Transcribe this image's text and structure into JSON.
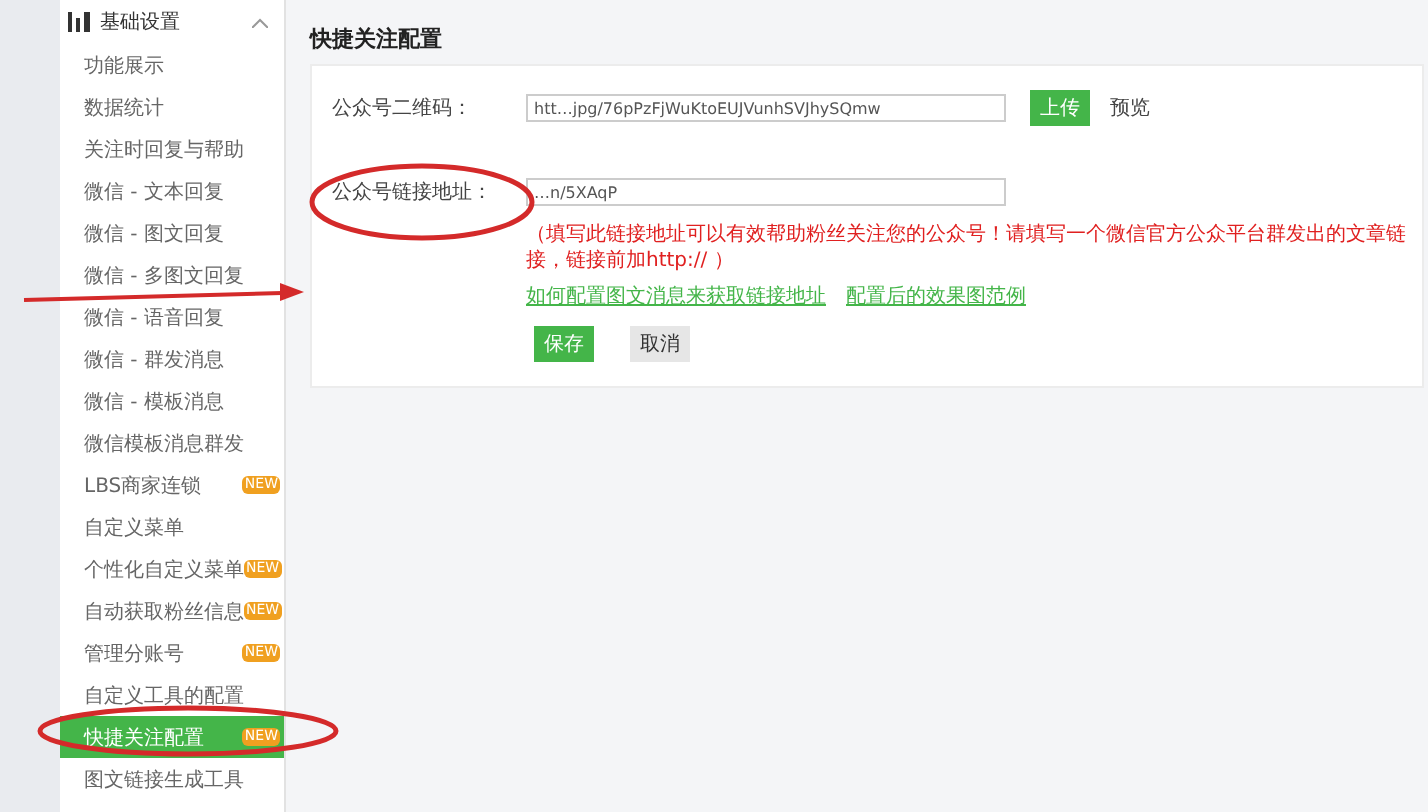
{
  "sidebar": {
    "header": {
      "title": "基础设置",
      "expanded": true
    },
    "items": [
      {
        "label": "功能展示",
        "selected": false
      },
      {
        "label": "数据统计",
        "selected": false
      },
      {
        "label": "关注时回复与帮助",
        "selected": false
      },
      {
        "label": "微信 - 文本回复",
        "selected": false
      },
      {
        "label": "微信 - 图文回复",
        "selected": false
      },
      {
        "label": "微信 - 多图文回复",
        "selected": false
      },
      {
        "label": "微信 - 语音回复",
        "selected": false
      },
      {
        "label": "微信 - 群发消息",
        "selected": false
      },
      {
        "label": "微信 - 模板消息",
        "selected": false
      },
      {
        "label": "微信模板消息群发",
        "selected": false
      },
      {
        "label": "LBS商家连锁",
        "selected": false,
        "badge": "NEW"
      },
      {
        "label": "自定义菜单",
        "selected": false
      },
      {
        "label": "个性化自定义菜单",
        "selected": false,
        "badge": "NEW"
      },
      {
        "label": "自动获取粉丝信息",
        "selected": false,
        "badge": "NEW"
      },
      {
        "label": "管理分账号",
        "selected": false,
        "badge": "NEW"
      },
      {
        "label": "自定义工具的配置",
        "selected": false
      },
      {
        "label": "快捷关注配置",
        "selected": true,
        "badge": "NEW"
      },
      {
        "label": "图文链接生成工具",
        "selected": false
      }
    ]
  },
  "main": {
    "title": "快捷关注配置",
    "fields": [
      {
        "kind": "qr",
        "label": "公众号二维码：",
        "value": "htt…jpg/76pPzFjWuKtoEUJVunhSVJhySQmw",
        "upload": "上传",
        "preview": "预览"
      },
      {
        "kind": "link",
        "label": "公众号链接地址：",
        "value": "…n/5XAqP"
      }
    ],
    "hint": "（填写此链接地址可以有效帮助粉丝关注您的公众号！请填写一个微信官方公众平台群发出的文章链接，链接前加http:// ）",
    "links": [
      "如何配置图文消息来获取链接地址",
      "配置后的效果图范例"
    ],
    "buttons": [
      {
        "label": "保存",
        "kind": "primary"
      },
      {
        "label": "取消",
        "kind": "default"
      }
    ]
  }
}
